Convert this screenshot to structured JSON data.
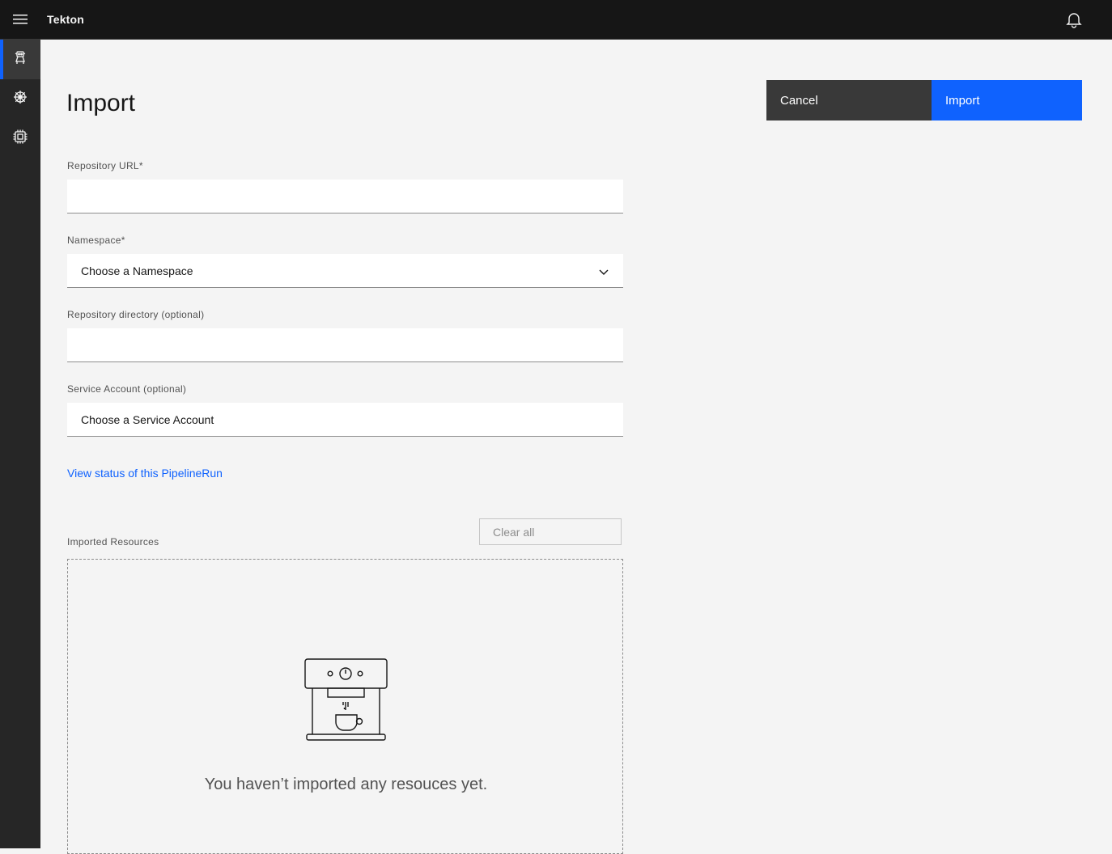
{
  "header": {
    "app_name": "Tekton",
    "menu_icon": "hamburger-menu-icon",
    "notification_icon": "bell-icon"
  },
  "sidenav": {
    "items": [
      {
        "icon": "tekton-robot-icon",
        "active": true
      },
      {
        "icon": "kubernetes-helm-icon",
        "active": false
      },
      {
        "icon": "chip-icon",
        "active": false
      }
    ]
  },
  "page": {
    "title": "Import",
    "cancel_label": "Cancel",
    "import_label": "Import"
  },
  "form": {
    "repo_url_label": "Repository URL*",
    "repo_url_value": "",
    "namespace_label": "Namespace*",
    "namespace_value": "Choose a Namespace",
    "repo_dir_label": "Repository directory (optional)",
    "repo_dir_value": "",
    "service_account_label": "Service Account (optional)",
    "service_account_value": "Choose a Service Account"
  },
  "link": {
    "status_label": "View status of this PipelineRun"
  },
  "resources": {
    "label": "Imported Resources",
    "clear_label": "Clear all",
    "empty_message": "You haven’t imported any resouces yet.",
    "empty_icon": "coffee-machine-icon"
  },
  "colors": {
    "primary": "#0f62fe",
    "header_bg": "#161616",
    "sidenav_bg": "#262626",
    "page_bg": "#f4f4f4"
  }
}
